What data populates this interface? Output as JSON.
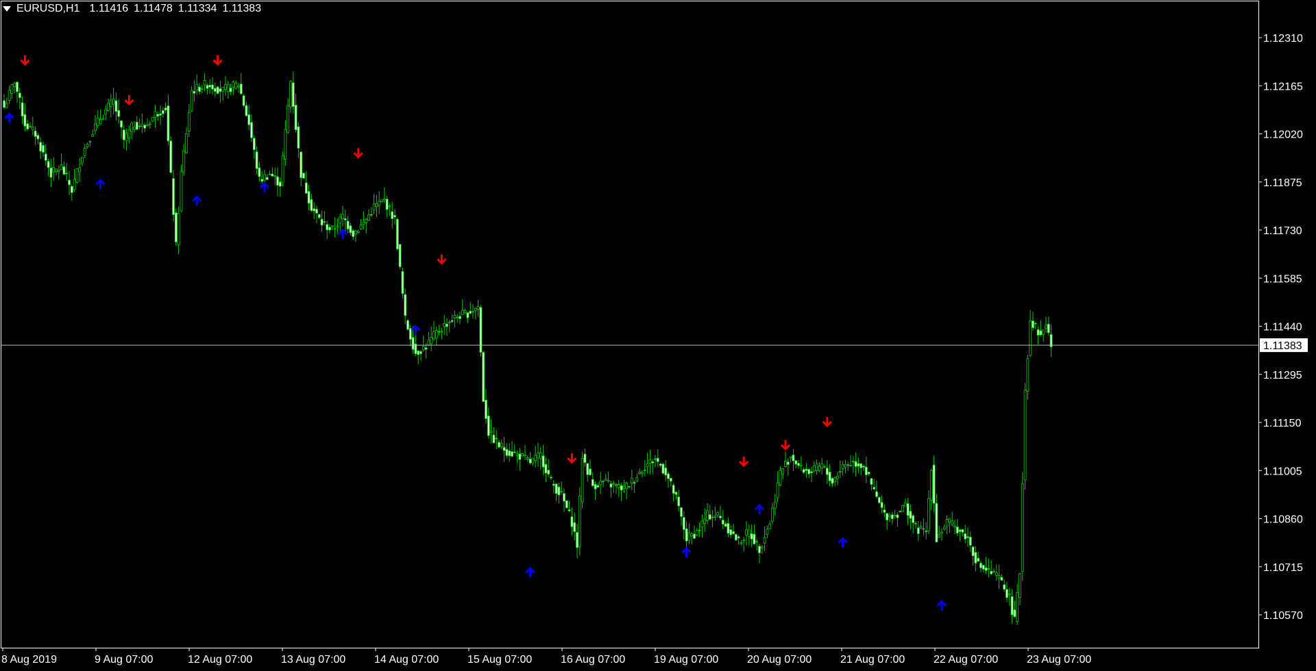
{
  "header": {
    "symbol": "EURUSD,H1",
    "open": "1.11416",
    "high": "1.11478",
    "low": "1.11334",
    "close": "1.11383"
  },
  "colors": {
    "background": "#000000",
    "bull_body": "#000000",
    "bear_body": "#ccffcc",
    "wick": "#00cc00",
    "arrow_buy": "#0000ff",
    "arrow_sell": "#ff0000",
    "frame": "#ffffff",
    "bid_line": "#c0c0c0",
    "text": "#ffffff"
  },
  "price_axis": {
    "labels": [
      "1.12310",
      "1.12165",
      "1.12020",
      "1.11875",
      "1.11730",
      "1.11585",
      "1.11440",
      "1.11295",
      "1.11150",
      "1.11005",
      "1.10860",
      "1.10715",
      "1.10570"
    ],
    "current_price": "1.11383"
  },
  "time_axis": {
    "labels": [
      "8 Aug 2019",
      "9 Aug 07:00",
      "12 Aug 07:00",
      "13 Aug 07:00",
      "14 Aug 07:00",
      "15 Aug 07:00",
      "16 Aug 07:00",
      "19 Aug 07:00",
      "20 Aug 07:00",
      "21 Aug 07:00",
      "22 Aug 07:00",
      "23 Aug 07:00"
    ]
  },
  "chart_data": {
    "type": "candlestick",
    "symbol": "EURUSD",
    "timeframe": "H1",
    "ylim": [
      1.1051,
      1.1238
    ],
    "y_ticks": [
      1.1231,
      1.12165,
      1.1202,
      1.11875,
      1.1173,
      1.11585,
      1.1144,
      1.11295,
      1.1115,
      1.11005,
      1.1086,
      1.10715,
      1.1057
    ],
    "close_path": [
      [
        0,
        1.121
      ],
      [
        4,
        1.1218
      ],
      [
        8,
        1.1205
      ],
      [
        12,
        1.1202
      ],
      [
        14,
        1.1198
      ],
      [
        18,
        1.119
      ],
      [
        22,
        1.1192
      ],
      [
        26,
        1.1185
      ],
      [
        30,
        1.1196
      ],
      [
        34,
        1.1203
      ],
      [
        38,
        1.1208
      ],
      [
        42,
        1.1212
      ],
      [
        46,
        1.12
      ],
      [
        50,
        1.1205
      ],
      [
        54,
        1.1204
      ],
      [
        58,
        1.1208
      ],
      [
        62,
        1.121
      ],
      [
        66,
        1.1168
      ],
      [
        68,
        1.119
      ],
      [
        72,
        1.1215
      ],
      [
        78,
        1.1217
      ],
      [
        84,
        1.1215
      ],
      [
        90,
        1.1217
      ],
      [
        94,
        1.1205
      ],
      [
        98,
        1.1188
      ],
      [
        102,
        1.119
      ],
      [
        106,
        1.1187
      ],
      [
        110,
        1.1218
      ],
      [
        114,
        1.119
      ],
      [
        118,
        1.118
      ],
      [
        122,
        1.1175
      ],
      [
        126,
        1.1173
      ],
      [
        130,
        1.1177
      ],
      [
        134,
        1.1172
      ],
      [
        138,
        1.1175
      ],
      [
        142,
        1.118
      ],
      [
        146,
        1.1182
      ],
      [
        150,
        1.1176
      ],
      [
        154,
        1.1146
      ],
      [
        158,
        1.1136
      ],
      [
        162,
        1.1138
      ],
      [
        166,
        1.1142
      ],
      [
        170,
        1.1145
      ],
      [
        174,
        1.1147
      ],
      [
        178,
        1.1148
      ],
      [
        182,
        1.115
      ],
      [
        184,
        1.1122
      ],
      [
        186,
        1.1112
      ],
      [
        190,
        1.1108
      ],
      [
        194,
        1.1106
      ],
      [
        198,
        1.1105
      ],
      [
        202,
        1.1103
      ],
      [
        206,
        1.1105
      ],
      [
        210,
        1.1097
      ],
      [
        214,
        1.1093
      ],
      [
        218,
        1.1085
      ],
      [
        220,
        1.1078
      ],
      [
        222,
        1.1105
      ],
      [
        226,
        1.1096
      ],
      [
        230,
        1.1097
      ],
      [
        234,
        1.1096
      ],
      [
        238,
        1.1095
      ],
      [
        242,
        1.1098
      ],
      [
        246,
        1.1102
      ],
      [
        250,
        1.1104
      ],
      [
        254,
        1.11
      ],
      [
        258,
        1.1092
      ],
      [
        262,
        1.108
      ],
      [
        266,
        1.1082
      ],
      [
        270,
        1.1087
      ],
      [
        274,
        1.1087
      ],
      [
        278,
        1.1083
      ],
      [
        282,
        1.1079
      ],
      [
        286,
        1.1082
      ],
      [
        290,
        1.1077
      ],
      [
        294,
        1.1085
      ],
      [
        298,
        1.11
      ],
      [
        302,
        1.1105
      ],
      [
        306,
        1.1101
      ],
      [
        310,
        1.11
      ],
      [
        314,
        1.1102
      ],
      [
        318,
        1.1097
      ],
      [
        322,
        1.1102
      ],
      [
        326,
        1.1103
      ],
      [
        330,
        1.1102
      ],
      [
        334,
        1.1094
      ],
      [
        338,
        1.1087
      ],
      [
        342,
        1.1087
      ],
      [
        346,
        1.109
      ],
      [
        350,
        1.1083
      ],
      [
        354,
        1.1082
      ],
      [
        356,
        1.1102
      ],
      [
        358,
        1.108
      ],
      [
        362,
        1.1085
      ],
      [
        366,
        1.1083
      ],
      [
        370,
        1.108
      ],
      [
        374,
        1.1072
      ],
      [
        378,
        1.107
      ],
      [
        382,
        1.1068
      ],
      [
        386,
        1.1062
      ],
      [
        388,
        1.1055
      ],
      [
        390,
        1.107
      ],
      [
        392,
        1.1125
      ],
      [
        394,
        1.1146
      ],
      [
        398,
        1.1141
      ],
      [
        400,
        1.1145
      ],
      [
        402,
        1.1138
      ]
    ],
    "sell_arrows": [
      [
        8,
        1.1223
      ],
      [
        48,
        1.1211
      ],
      [
        82,
        1.1223
      ],
      [
        136,
        1.1195
      ],
      [
        168,
        1.1163
      ],
      [
        218,
        1.1103
      ],
      [
        284,
        1.1102
      ],
      [
        300,
        1.1107
      ],
      [
        316,
        1.1114
      ]
    ],
    "buy_arrows": [
      [
        2,
        1.1208
      ],
      [
        37,
        1.1188
      ],
      [
        74,
        1.1183
      ],
      [
        100,
        1.1187
      ],
      [
        130,
        1.1173
      ],
      [
        158,
        1.1144
      ],
      [
        202,
        1.1071
      ],
      [
        262,
        1.1077
      ],
      [
        290,
        1.109
      ],
      [
        322,
        1.108
      ],
      [
        360,
        1.1061
      ]
    ]
  }
}
